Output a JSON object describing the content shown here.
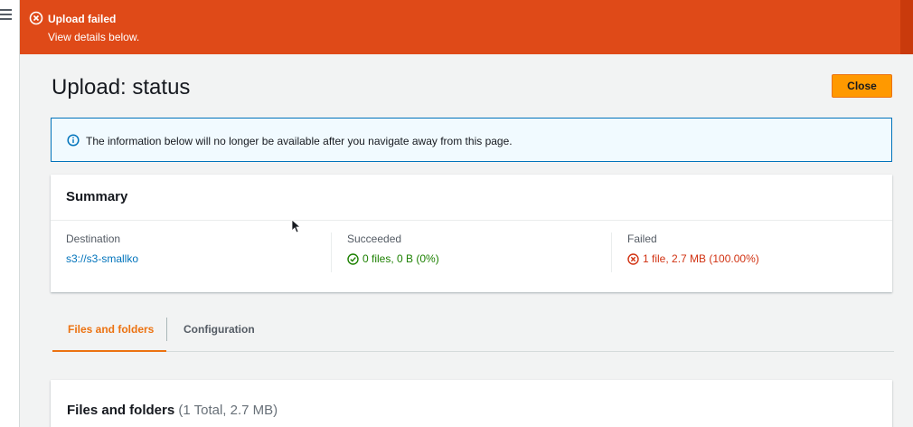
{
  "flash": {
    "title": "Upload failed",
    "description": "View details below."
  },
  "page": {
    "title": "Upload: status",
    "close_label": "Close"
  },
  "info_alert": {
    "text": "The information below will no longer be available after you navigate away from this page."
  },
  "summary": {
    "header": "Summary",
    "destination": {
      "label": "Destination",
      "value": "s3://s3-smallko"
    },
    "succeeded": {
      "label": "Succeeded",
      "value": "0 files, 0 B (0%)"
    },
    "failed": {
      "label": "Failed",
      "value": "1 file, 2.7 MB (100.00%)"
    }
  },
  "tabs": [
    {
      "label": "Files and folders",
      "active": true
    },
    {
      "label": "Configuration",
      "active": false
    }
  ],
  "files_section": {
    "title": "Files and folders",
    "count": "(1 Total, 2.7 MB)"
  },
  "colors": {
    "flash_error": "#df4a18",
    "primary_button": "#ff9900",
    "link": "#0073bb",
    "success": "#1d8102",
    "error": "#d13212",
    "active_tab": "#ec7211"
  },
  "icons": {
    "menu": "menu-icon",
    "flash_status": "error-circle-icon",
    "info": "info-icon",
    "succeeded": "success-check-icon",
    "failed": "error-x-icon",
    "cursor": "mouse-pointer-icon"
  }
}
